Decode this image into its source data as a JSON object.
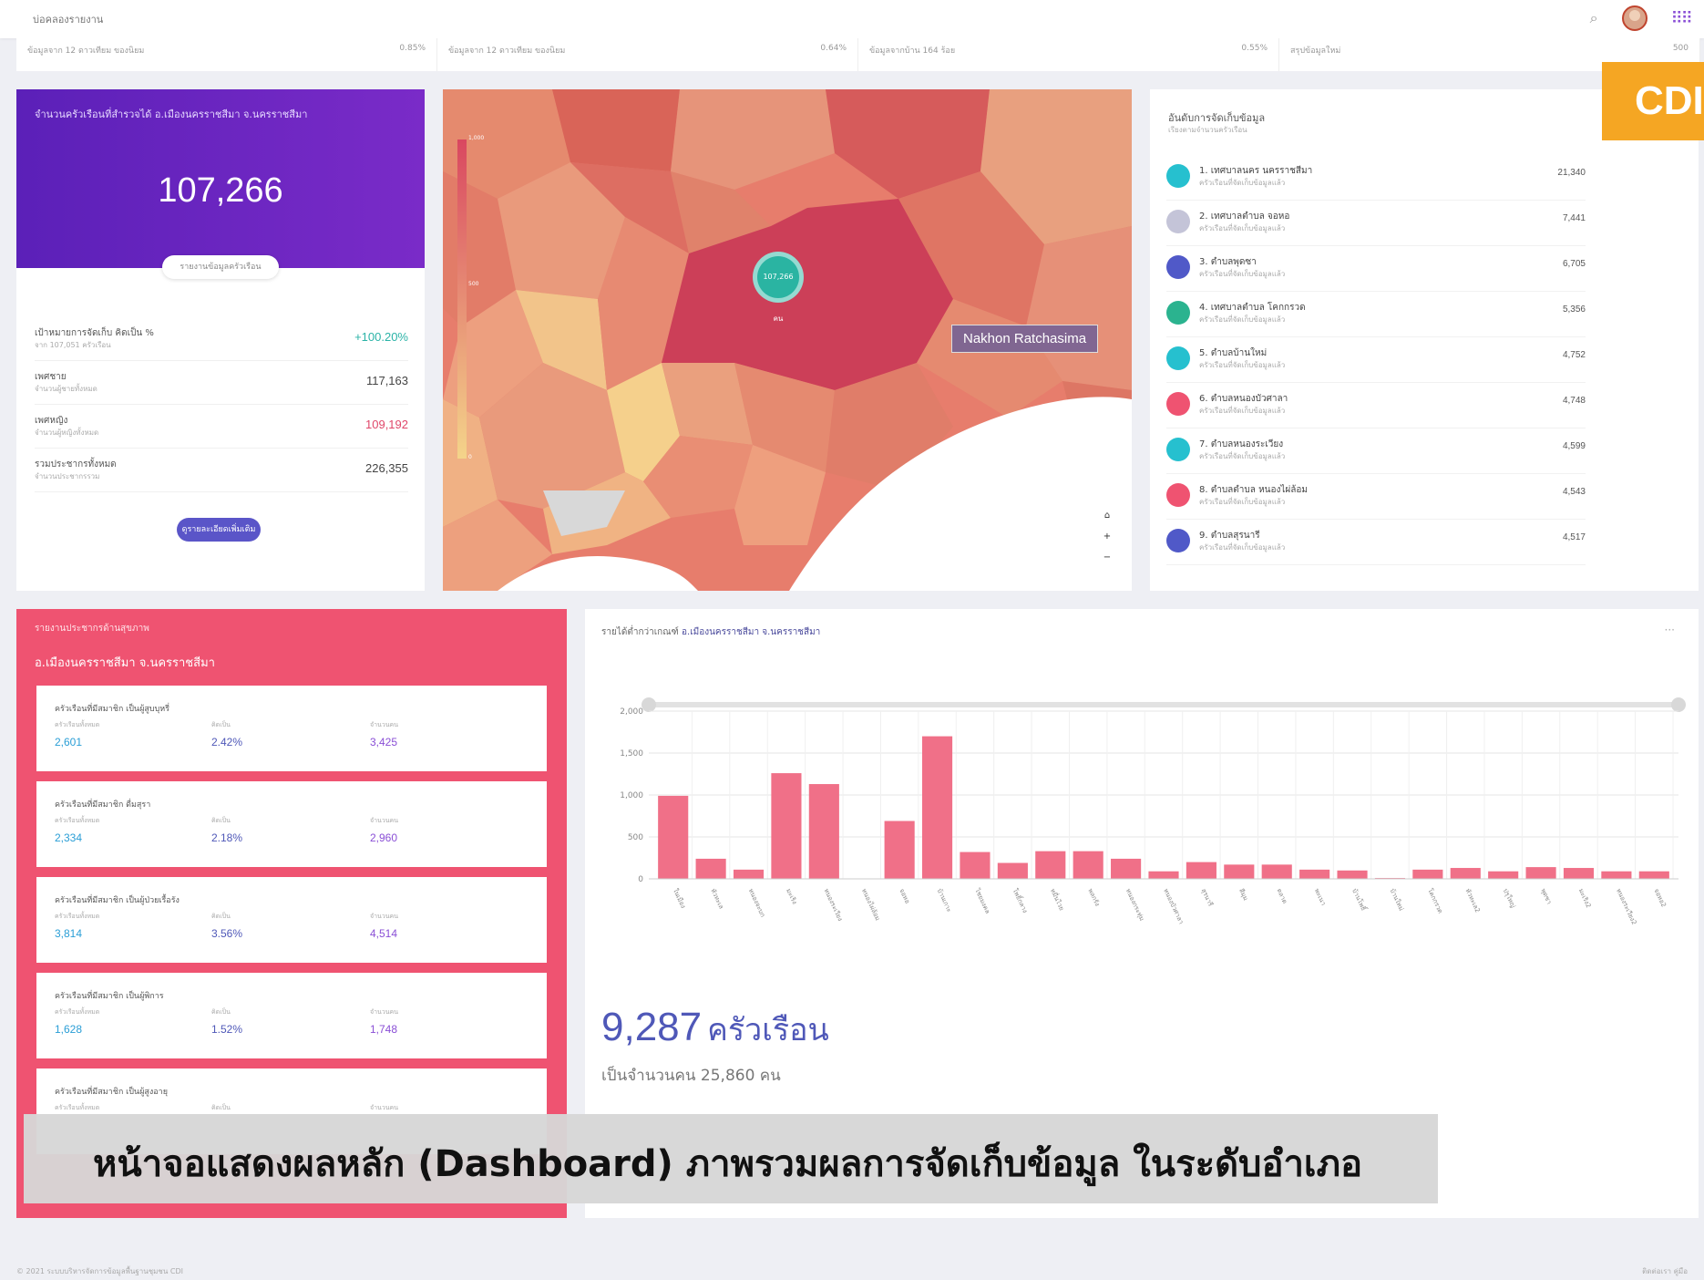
{
  "topbar": {
    "brand": "บ่อคลองรายงาน"
  },
  "stripe": [
    {
      "left": "ข้อมูลจาก 12 ดาวเทียม ของนิยม",
      "right": "0.85%"
    },
    {
      "left": "ข้อมูลจาก 12 ดาวเทียม ของนิยม",
      "right": "0.64%"
    },
    {
      "left": "ข้อมูลจากบ้าน 164 ร้อย",
      "right": "0.55%"
    },
    {
      "left": "สรุปข้อมูลใหม่",
      "right": "500"
    }
  ],
  "cdi_label": "CDI",
  "summary": {
    "title": "จำนวนครัวเรือนที่สำรวจได้ อ.เมืองนครราชสีมา จ.นครราชสีมา",
    "total": "107,266",
    "pill": "รายงานข้อมูลครัวเรือน",
    "rows": [
      {
        "label": "เป้าหมายการจัดเก็บ คิดเป็น %",
        "sub": "จาก 107,051 ครัวเรือน",
        "value": "+100.20%",
        "color": "#2bb3a7"
      },
      {
        "label": "เพศชาย",
        "sub": "จำนวนผู้ชายทั้งหมด",
        "value": "117,163",
        "color": "#444"
      },
      {
        "label": "เพศหญิง",
        "sub": "จำนวนผู้หญิงทั้งหมด",
        "value": "109,192",
        "color": "#e0476a"
      },
      {
        "label": "รวมประชากรทั้งหมด",
        "sub": "จำนวนประชากรรวม",
        "value": "226,355",
        "color": "#444"
      }
    ],
    "button": "ดูรายละเอียดเพิ่มเติม"
  },
  "map": {
    "tooltip": "Nakhon Ratchasima",
    "pin": "107,266 คน",
    "legend_top": "1,000",
    "legend_mid": "500",
    "legend_bot": "0"
  },
  "ranking": {
    "title": "อันดับการจัดเก็บข้อมูล",
    "sub": "เรียงตามจำนวนครัวเรือน",
    "items": [
      {
        "name": "1. เทศบาลนคร นครราชสีมา",
        "sub": "ครัวเรือนที่จัดเก็บข้อมูลแล้ว",
        "value": "21,340",
        "color": "#26c0cf"
      },
      {
        "name": "2. เทศบาลตำบล จอหอ",
        "sub": "ครัวเรือนที่จัดเก็บข้อมูลแล้ว",
        "value": "7,441",
        "color": "#c4c4d8"
      },
      {
        "name": "3. ตำบลพุดซา",
        "sub": "ครัวเรือนที่จัดเก็บข้อมูลแล้ว",
        "value": "6,705",
        "color": "#5059c8"
      },
      {
        "name": "4. เทศบาลตำบล โคกกรวด",
        "sub": "ครัวเรือนที่จัดเก็บข้อมูลแล้ว",
        "value": "5,356",
        "color": "#2bb38f"
      },
      {
        "name": "5. ตำบลบ้านใหม่",
        "sub": "ครัวเรือนที่จัดเก็บข้อมูลแล้ว",
        "value": "4,752",
        "color": "#26c0cf"
      },
      {
        "name": "6. ตำบลหนองบัวศาลา",
        "sub": "ครัวเรือนที่จัดเก็บข้อมูลแล้ว",
        "value": "4,748",
        "color": "#ef5371"
      },
      {
        "name": "7. ตำบลหนองระเวียง",
        "sub": "ครัวเรือนที่จัดเก็บข้อมูลแล้ว",
        "value": "4,599",
        "color": "#26c0cf"
      },
      {
        "name": "8. ตำบลตำบล หนองไผ่ล้อม",
        "sub": "ครัวเรือนที่จัดเก็บข้อมูลแล้ว",
        "value": "4,543",
        "color": "#ef5371"
      },
      {
        "name": "9. ตำบลสุรนารี",
        "sub": "ครัวเรือนที่จัดเก็บข้อมูลแล้ว",
        "value": "4,517",
        "color": "#5059c8"
      }
    ]
  },
  "health": {
    "title": "รายงานประชากรด้านสุขภาพ",
    "district": "อ.เมืองนครราชสีมา จ.นครราชสีมา",
    "col_labels": [
      "ครัวเรือนทั้งหมด",
      "คิดเป็น",
      "จำนวนคน"
    ],
    "cards": [
      {
        "title": "ครัวเรือนที่มีสมาชิก เป็นผู้สูบบุหรี่",
        "a": "2,601",
        "b": "2.42%",
        "c": "3,425"
      },
      {
        "title": "ครัวเรือนที่มีสมาชิก ดื่มสุรา",
        "a": "2,334",
        "b": "2.18%",
        "c": "2,960"
      },
      {
        "title": "ครัวเรือนที่มีสมาชิก เป็นผู้ป่วยเรื้อรัง",
        "a": "3,814",
        "b": "3.56%",
        "c": "4,514"
      },
      {
        "title": "ครัวเรือนที่มีสมาชิก เป็นผู้พิการ",
        "a": "1,628",
        "b": "1.52%",
        "c": "1,748"
      },
      {
        "title": "ครัวเรือนที่มีสมาชิก เป็นผู้สูงอายุ",
        "a": "",
        "b": "",
        "c": ""
      }
    ]
  },
  "chart_panel": {
    "title_prefix": "รายได้ต่ำกว่าเกณฑ์",
    "title_place": "อ.เมืองนครราชสีมา จ.นครราชสีมา",
    "more": "···",
    "big_value": "9,287",
    "big_unit": "ครัวเรือน",
    "sub": "เป็นจำนวนคน 25,860 คน"
  },
  "chart_data": {
    "type": "bar",
    "categories": [
      "ในเมือง",
      "หัวทะเล",
      "หนองจะบก",
      "มะเริง",
      "หนองระเวียง",
      "หนองไผ่ล้อม",
      "จอหอ",
      "บ้านเกาะ",
      "ไชยมงคล",
      "โพธิ์กลาง",
      "หมื่นไวย",
      "พลกรัง",
      "หนองกระทุ่ม",
      "หนองบัวศาลา",
      "สุรนารี",
      "สีมุม",
      "ตลาด",
      "พะเนา",
      "บ้านโพธิ์",
      "บ้านใหม่",
      "โคกกรวด",
      "หัวทะเล2",
      "ปรุใหญ่",
      "พุดซา",
      "มะเริง2",
      "หนองระเวียง2",
      "จอหอ2",
      "บ้านเกาะ2"
    ],
    "values": [
      990,
      240,
      110,
      1260,
      1130,
      0,
      690,
      1700,
      320,
      190,
      330,
      330,
      240,
      90,
      200,
      170,
      170,
      110,
      100,
      10,
      110,
      130,
      90,
      140,
      130,
      90,
      90
    ],
    "ylim": [
      0,
      2000
    ],
    "yticks": [
      "0",
      "500",
      "1,000",
      "1,500",
      "2,000"
    ],
    "color": "#f07088"
  },
  "banner": "หน้าจอแสดงผลหลัก (Dashboard) ภาพรวมผลการจัดเก็บข้อมูล ในระดับอำเภอ",
  "footer": {
    "left": "© 2021 ระบบบริหารจัดการข้อมูลพื้นฐานชุมชน CDI",
    "right": "ติดต่อเรา  คู่มือ"
  }
}
